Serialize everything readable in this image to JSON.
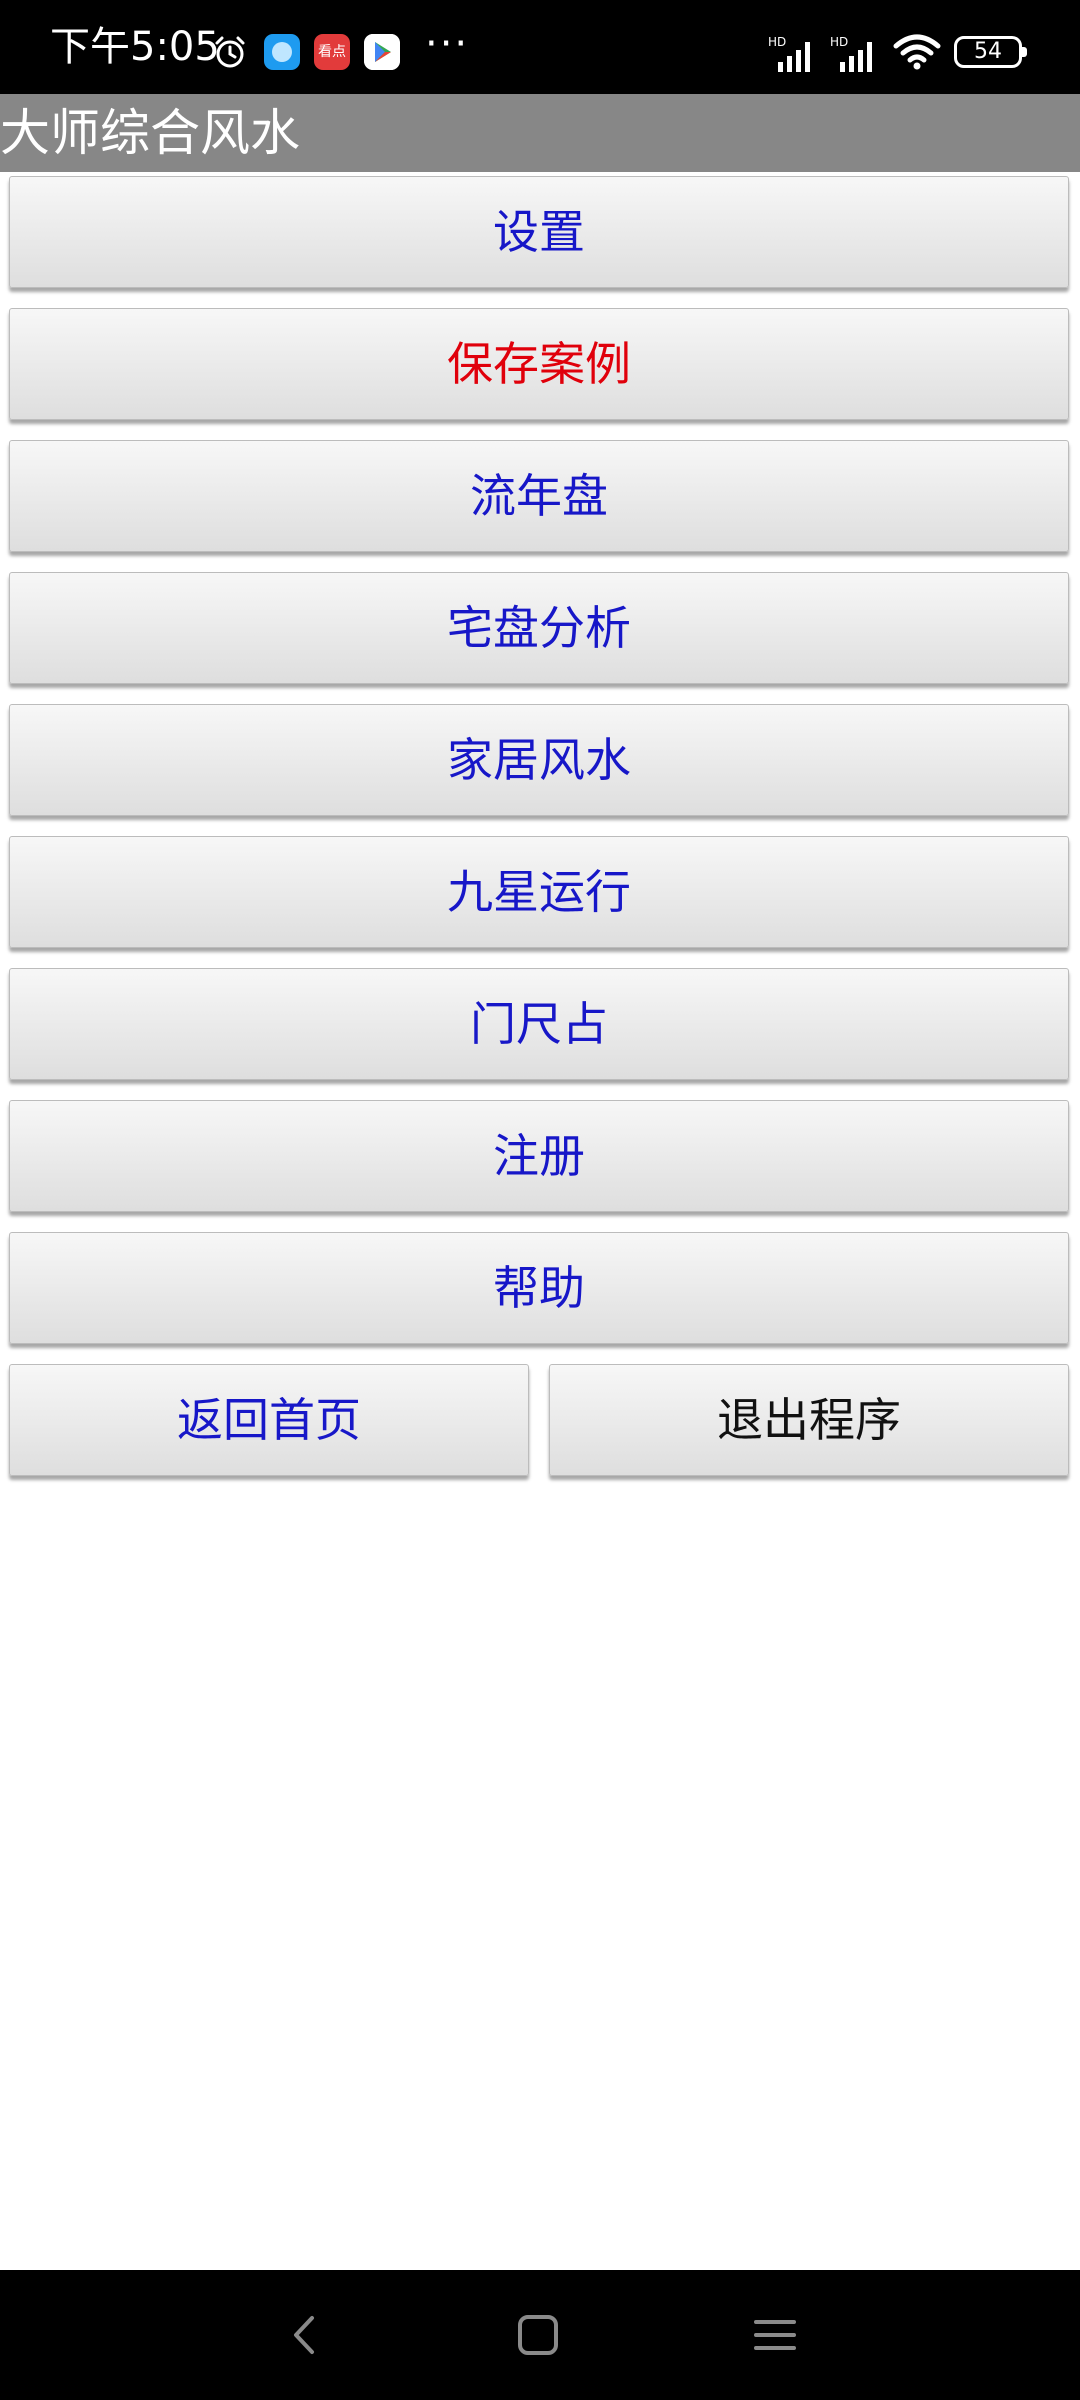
{
  "status_bar": {
    "time": "下午5:05",
    "battery": "54",
    "more": "···",
    "app2_label": "看点",
    "icons": [
      "alarm-icon",
      "app-icon-blue",
      "app-icon-red",
      "play-store-icon",
      "hd-signal-icon",
      "hd-signal-icon",
      "wifi-icon",
      "battery-icon"
    ]
  },
  "app": {
    "title": "大师综合风水"
  },
  "menu": {
    "settings": "设置",
    "save_case": "保存案例",
    "annual_chart": "流年盘",
    "house_analysis": "宅盘分析",
    "home_fengshui": "家居风水",
    "nine_star": "九星运行",
    "door_ruler": "门尺占",
    "register": "注册",
    "help": "帮助",
    "back_home": "返回首页",
    "exit": "退出程序"
  },
  "colors": {
    "title_bar": "#878787",
    "button_text": "#1717c8",
    "highlight_text": "#e0000b",
    "exit_text": "#111111"
  },
  "nav_bar": {
    "icons": [
      "back-icon",
      "home-icon",
      "menu-icon"
    ]
  }
}
